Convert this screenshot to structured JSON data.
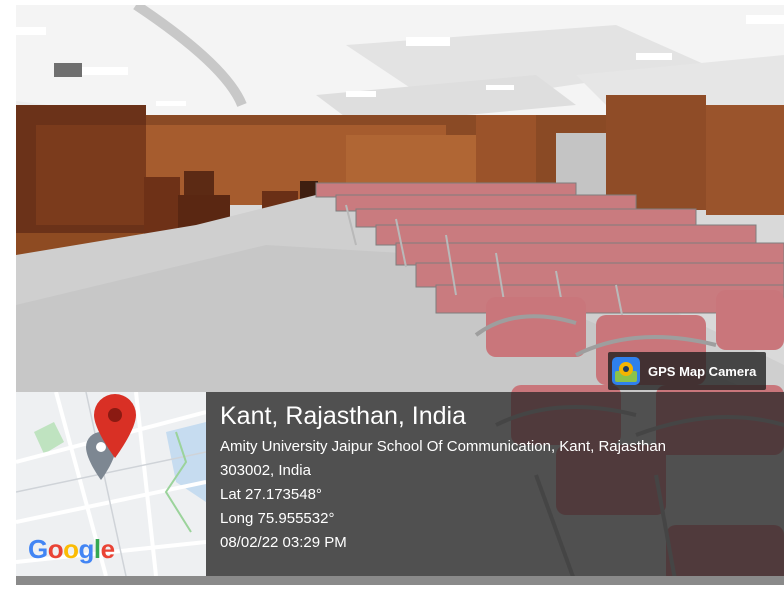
{
  "badge": {
    "text": "GPS Map Camera",
    "icon": "gps-map-camera-app-icon"
  },
  "map": {
    "logo": [
      "G",
      "o",
      "o",
      "g",
      "l",
      "e"
    ],
    "pin_icon": "map-pin-icon",
    "marker_color": "#d93025"
  },
  "location": {
    "title": "Kant, Rajasthan, India",
    "address_line1": "Amity University Jaipur School Of Communication, Kant, Rajasthan",
    "address_line2": "303002, India",
    "lat": "Lat 27.173548°",
    "long": "Long 75.955532°",
    "datetime": "08/02/22 03:29 PM"
  },
  "colors": {
    "chair": "#c97b7f",
    "wood": "#7a3f1e",
    "carpet": "#cfcfcf",
    "ceiling": "#eeeeee",
    "overlay": "#262626"
  }
}
